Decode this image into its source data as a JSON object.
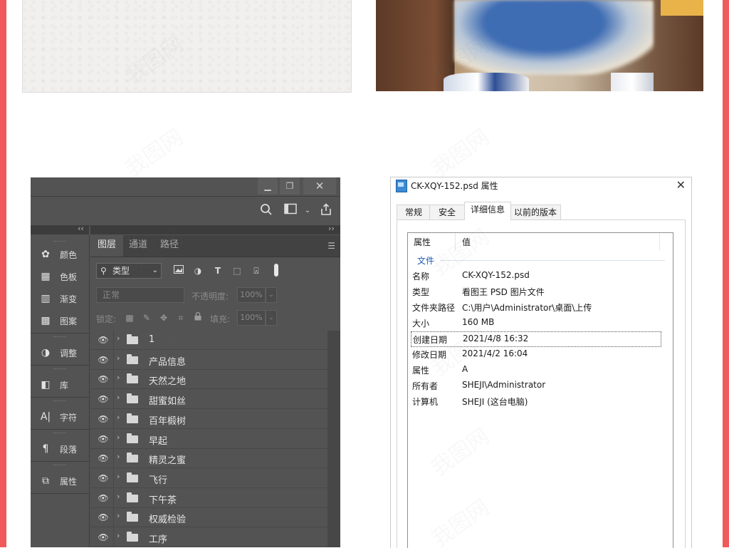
{
  "photoshop": {
    "window_buttons": {
      "minimize": "▁",
      "restore": "❐",
      "close": "✕"
    },
    "options_icons": [
      "search-icon",
      "workspace-icon",
      "share-icon"
    ],
    "dock": [
      {
        "label": "颜色",
        "icon": "color-icon",
        "glyph": "✿"
      },
      {
        "label": "色板",
        "icon": "swatches-icon",
        "glyph": "▦"
      },
      {
        "label": "渐变",
        "icon": "gradient-icon",
        "glyph": "▥"
      },
      {
        "label": "图案",
        "icon": "pattern-icon",
        "glyph": "▩"
      },
      {
        "label": "调整",
        "icon": "adjustments-icon",
        "glyph": "◑"
      },
      {
        "label": "库",
        "icon": "libraries-icon",
        "glyph": "◧"
      },
      {
        "label": "字符",
        "icon": "character-icon",
        "glyph": "A|"
      },
      {
        "label": "段落",
        "icon": "paragraph-icon",
        "glyph": "¶"
      },
      {
        "label": "属性",
        "icon": "properties-icon",
        "glyph": "⧉"
      }
    ],
    "tabs": [
      "图层",
      "通道",
      "路径"
    ],
    "active_tab": "图层",
    "filter": {
      "kind_value": "类型"
    },
    "blend_mode": "正常",
    "opacity_label": "不透明度:",
    "opacity_value": "100%",
    "lock_label": "锁定:",
    "fill_label": "填充:",
    "fill_value": "100%",
    "layers": [
      "1",
      "产品信息",
      "天然之地",
      "甜蜜如丝",
      "百年椴树",
      "早起",
      "精灵之蜜",
      "飞行",
      "下午茶",
      "权威检验",
      "工序"
    ]
  },
  "dialog": {
    "title": "CK-XQY-152.psd 属性",
    "close": "✕",
    "tabs": [
      "常规",
      "安全",
      "详细信息",
      "以前的版本"
    ],
    "active_tab": "详细信息",
    "header": {
      "property": "属性",
      "value": "值"
    },
    "group": "文件",
    "rows": [
      {
        "key": "名称",
        "value": "CK-XQY-152.psd"
      },
      {
        "key": "类型",
        "value": "看图王 PSD 图片文件"
      },
      {
        "key": "文件夹路径",
        "value": "C:\\用户\\Administrator\\桌面\\上传"
      },
      {
        "key": "大小",
        "value": "160 MB"
      },
      {
        "key": "创建日期",
        "value": "2021/4/8 16:32"
      },
      {
        "key": "修改日期",
        "value": "2021/4/2 16:04"
      },
      {
        "key": "属性",
        "value": "A"
      },
      {
        "key": "所有者",
        "value": "SHEJI\\Administrator"
      },
      {
        "key": "计算机",
        "value": "SHEJI (这台电脑)"
      }
    ],
    "selected_row": 4
  },
  "watermark": "我图网",
  "colors": {
    "accent_border": "#f05a5a",
    "ps_bg": "#535353",
    "link_blue": "#1e5bb8"
  }
}
